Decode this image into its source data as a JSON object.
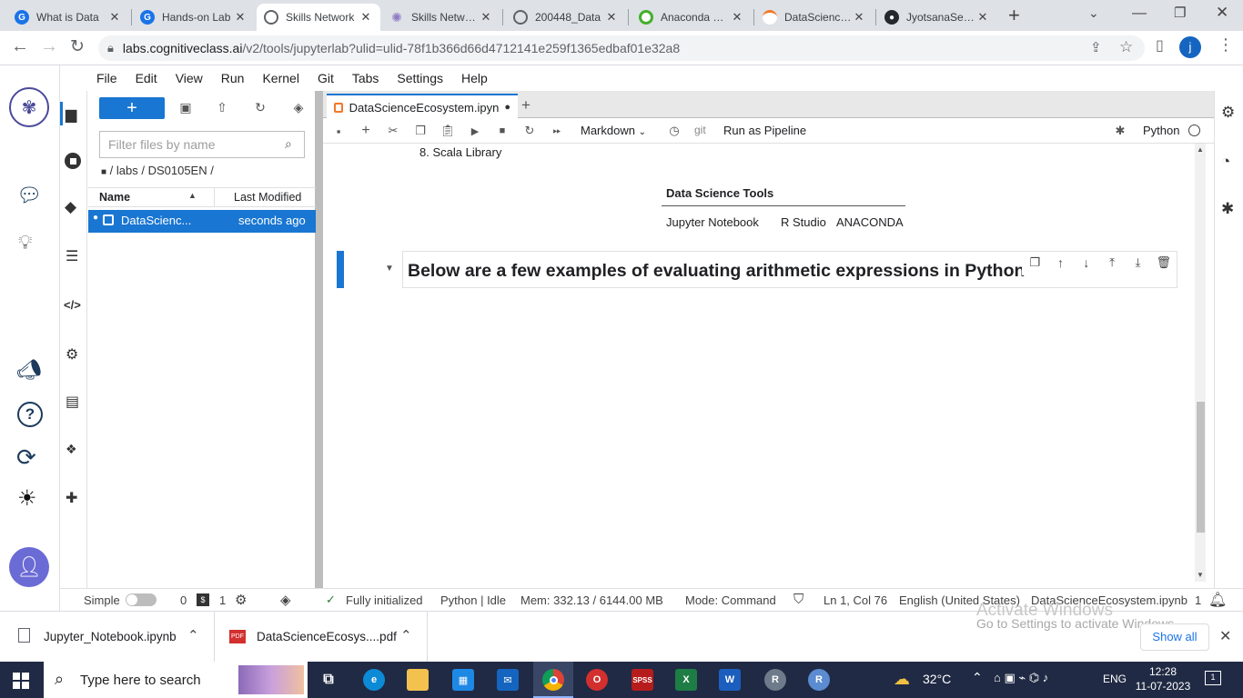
{
  "browser": {
    "tabs": [
      {
        "title": "What is Data",
        "fav": "G"
      },
      {
        "title": "Hands-on Lab",
        "fav": "G"
      },
      {
        "title": "Skills Network",
        "fav": ""
      },
      {
        "title": "Skills Network",
        "fav": ""
      },
      {
        "title": "200448_Data",
        "fav": ""
      },
      {
        "title": "Anaconda Cloud",
        "fav": ""
      },
      {
        "title": "DataScienceE",
        "fav": ""
      },
      {
        "title": "JyotsanaSewa",
        "fav": ""
      }
    ],
    "new_tab": "+",
    "url_host": "labs.cognitiveclass.ai",
    "url_path": "/v2/tools/jupyterlab?ulid=ulid-78f1b366d66d4712141e259f1365edbaf01e32a8",
    "profile_initial": "j"
  },
  "menu": [
    "File",
    "Edit",
    "View",
    "Run",
    "Kernel",
    "Git",
    "Tabs",
    "Settings",
    "Help"
  ],
  "filebrowser": {
    "new_label": "+",
    "filter_placeholder": "Filter files by name",
    "breadcrumb": "/ labs / DS0105EN /",
    "col_name": "Name",
    "col_modified": "Last Modified",
    "files": [
      {
        "name": "DataScienc...",
        "modified": "seconds ago"
      }
    ]
  },
  "notebook": {
    "tab_title": "DataScienceEcosystem.ipyn",
    "cell_type": "Markdown",
    "git_label": "git",
    "run_pipeline": "Run as Pipeline",
    "kernel": "Python",
    "list_item": "8. Scala Library",
    "table_header": "Data Science Tools",
    "table_cells": [
      "Jupyter Notebook",
      "R Studio",
      "ANACONDA"
    ],
    "heading": "Below are a few examples of evaluating arithmetic expressions in Python"
  },
  "status": {
    "mode_label": "Simple",
    "count0": "0",
    "count1": "1",
    "init": "Fully initialized",
    "kernel_state": "Python | Idle",
    "mem": "Mem: 332.13 / 6144.00 MB",
    "cmd_mode": "Mode: Command",
    "position": "Ln 1, Col 76",
    "lang": "English (United States)",
    "file": "DataScienceEcosystem.ipynb",
    "notif": "1"
  },
  "downloads": {
    "items": [
      "Jupyter_Notebook.ipynb",
      "DataScienceEcosys....pdf"
    ],
    "show_all": "Show all",
    "activate_title": "Activate Windows",
    "activate_sub": "Go to Settings to activate Windows."
  },
  "taskbar": {
    "search": "Type here to search",
    "temp": "32°C",
    "lang": "ENG",
    "time": "12:28",
    "date": "11-07-2023",
    "notif": "1"
  },
  "colors": {
    "accent": "#1976d2",
    "taskbar": "#202a44"
  }
}
